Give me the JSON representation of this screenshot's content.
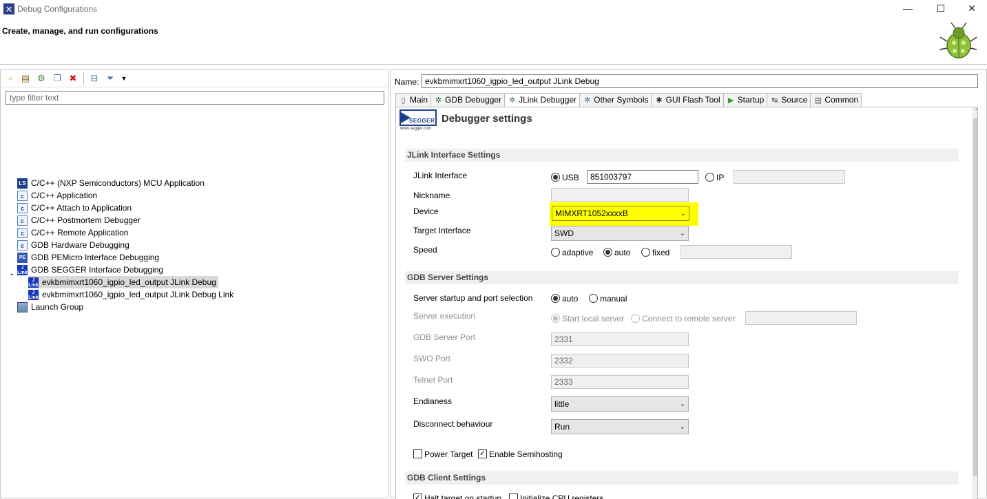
{
  "window": {
    "title": "Debug Configurations",
    "minimize": "—",
    "maximize": "☐",
    "close": "✕"
  },
  "header": {
    "title": "Create, manage, and run configurations"
  },
  "left": {
    "filter_placeholder": "type filter text",
    "tree": [
      {
        "label": "C/C++ (NXP Semiconductors) MCU Application",
        "icon": "ls-icon"
      },
      {
        "label": "C/C++ Application",
        "icon": "c-icon"
      },
      {
        "label": "C/C++ Attach to Application",
        "icon": "c-icon"
      },
      {
        "label": "C/C++ Postmortem Debugger",
        "icon": "c-icon"
      },
      {
        "label": "C/C++ Remote Application",
        "icon": "c-icon"
      },
      {
        "label": "GDB Hardware Debugging",
        "icon": "c-icon"
      },
      {
        "label": "GDB PEMicro Interface Debugging",
        "icon": "pe-icon"
      },
      {
        "label": "GDB SEGGER Interface Debugging",
        "icon": "jlink-icon"
      },
      {
        "label": "evkbmimxrt1060_igpio_led_output JLink Debug",
        "icon": "jlink-icon"
      },
      {
        "label": "evkbmimxrt1060_igpio_led_output JLink Debug Link",
        "icon": "jlink-icon"
      },
      {
        "label": "Launch Group",
        "icon": "launch-group-icon"
      }
    ]
  },
  "right": {
    "name_label": "Name:",
    "name_value": "evkbmimxrt1060_igpio_led_output JLink Debug",
    "tabs": [
      {
        "label": "Main",
        "icon": "main-icon"
      },
      {
        "label": "GDB Debugger",
        "icon": "bug-icon"
      },
      {
        "label": "JLink Debugger",
        "icon": "bug-icon"
      },
      {
        "label": "Other Symbols",
        "icon": "bug-icon"
      },
      {
        "label": "GUI Flash Tool",
        "icon": "flash-icon"
      },
      {
        "label": "Startup",
        "icon": "play-icon"
      },
      {
        "label": "Source",
        "icon": "source-icon"
      },
      {
        "label": "Common",
        "icon": "common-icon"
      }
    ],
    "heading": "Debugger settings",
    "logo_text": "SEGGER",
    "logo_sub": "www.segger.com",
    "jlink": {
      "section": "JLink Interface Settings",
      "interface_label": "JLink Interface",
      "usb_label": "USB",
      "usb_value": "851003797",
      "ip_label": "IP",
      "ip_value": "",
      "nickname_label": "Nickname",
      "nickname_value": "",
      "device_label": "Device",
      "device_value": "MIMXRT1052xxxxB",
      "target_label": "Target Interface",
      "target_value": "SWD",
      "speed_label": "Speed",
      "speed_adaptive": "adaptive",
      "speed_auto": "auto",
      "speed_fixed": "fixed",
      "speed_fixed_value": ""
    },
    "gdbserver": {
      "section": "GDB Server Settings",
      "startup_label": "Server startup and port selection",
      "auto_label": "auto",
      "manual_label": "manual",
      "execution_label": "Server execution",
      "start_local": "Start local server",
      "connect_remote": "Connect to remote server",
      "remote_value": "",
      "port_label": "GDB Server Port",
      "port_value": "2331",
      "swo_label": "SWO Port",
      "swo_value": "2332",
      "telnet_label": "Telnet Port",
      "telnet_value": "2333",
      "endianess_label": "Endianess",
      "endianess_value": "little",
      "disconnect_label": "Disconnect behaviour",
      "disconnect_value": "Run",
      "power_target": "Power Target",
      "semihosting": "Enable Semihosting"
    },
    "gdbclient": {
      "section": "GDB Client Settings",
      "halt_target": "Halt target on startup",
      "init_cpu": "Initialize CPU registers"
    }
  }
}
